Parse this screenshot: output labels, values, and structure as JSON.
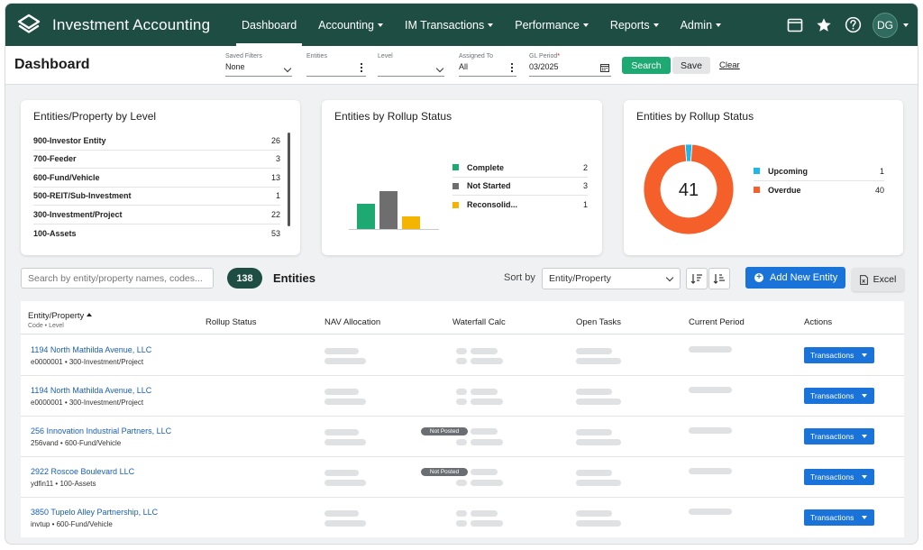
{
  "app": {
    "title": "Investment Accounting",
    "avatar_initials": "DG"
  },
  "nav": [
    {
      "label": "Dashboard",
      "active": true,
      "dropdown": false
    },
    {
      "label": "Accounting",
      "dropdown": true
    },
    {
      "label": "IM Transactions",
      "dropdown": true
    },
    {
      "label": "Performance",
      "dropdown": true
    },
    {
      "label": "Reports",
      "dropdown": true
    },
    {
      "label": "Admin",
      "dropdown": true
    }
  ],
  "header": {
    "title": "Dashboard",
    "filters": {
      "saved_filters": {
        "label": "Saved Filters",
        "value": "None"
      },
      "entities": {
        "label": "Entities",
        "value": ""
      },
      "level": {
        "label": "Level",
        "value": ""
      },
      "assigned_to": {
        "label": "Assigned To",
        "value": "All"
      },
      "gl_period": {
        "label": "GL Period",
        "required_mark": "*",
        "value": "03/2025"
      }
    },
    "search_label": "Search",
    "save_label": "Save",
    "clear_label": "Clear"
  },
  "cards": {
    "levels": {
      "title": "Entities/Property by Level",
      "rows": [
        {
          "label": "900-Investor Entity",
          "count": "26"
        },
        {
          "label": "700-Feeder",
          "count": "3"
        },
        {
          "label": "600-Fund/Vehicle",
          "count": "13"
        },
        {
          "label": "500-REIT/Sub-Investment",
          "count": "1"
        },
        {
          "label": "300-Investment/Project",
          "count": "22"
        },
        {
          "label": "100-Assets",
          "count": "53"
        }
      ]
    },
    "rollup_bar": {
      "title": "Entities by Rollup Status",
      "legend": [
        {
          "label": "Complete",
          "count": "2",
          "color": "#1fa972"
        },
        {
          "label": "Not Started",
          "count": "3",
          "color": "#6e6e6e"
        },
        {
          "label": "Reconsolid...",
          "count": "1",
          "color": "#f5b400"
        }
      ]
    },
    "rollup_donut": {
      "title": "Entities by Rollup Status",
      "total": "41",
      "legend": [
        {
          "label": "Upcoming",
          "count": "1",
          "color": "#1fb6e8"
        },
        {
          "label": "Overdue",
          "count": "40",
          "color": "#f5602a"
        }
      ]
    }
  },
  "chart_data": [
    {
      "type": "bar",
      "categories": [
        "Complete",
        "Not Started",
        "Reconsolid..."
      ],
      "values": [
        2,
        3,
        1
      ],
      "colors": [
        "#1fa972",
        "#6e6e6e",
        "#f5b400"
      ],
      "ylim": [
        0,
        3
      ]
    },
    {
      "type": "pie",
      "categories": [
        "Upcoming",
        "Overdue"
      ],
      "values": [
        1,
        40
      ],
      "colors": [
        "#1fb6e8",
        "#f5602a"
      ],
      "center_label": "41"
    }
  ],
  "toolbar": {
    "search_placeholder": "Search by entity/property names, codes...",
    "count": "138",
    "entities_label": "Entities",
    "sort_by_label": "Sort by",
    "sort_value": "Entity/Property",
    "add_label": "Add New Entity",
    "excel_label": "Excel"
  },
  "table": {
    "columns": {
      "entity": "Entity/Property",
      "entity_sub": "Code • Level",
      "rollup": "Rollup Status",
      "nav": "NAV Allocation",
      "waterfall": "Waterfall Calc",
      "tasks": "Open Tasks",
      "period": "Current Period",
      "actions": "Actions"
    },
    "action_label": "Transactions",
    "rows": [
      {
        "name": "1194 North Mathilda Avenue, LLC",
        "sub": "e0000001 • 300-Investment/Project",
        "badge": ""
      },
      {
        "name": "1194 North Mathilda Avenue, LLC",
        "sub": "e0000001 • 300-Investment/Project",
        "badge": ""
      },
      {
        "name": "256 Innovation Industrial Partners, LLC",
        "sub": "256vand • 600-Fund/Vehicle",
        "badge": "Not Posted"
      },
      {
        "name": "2922 Roscoe Boulevard LLC",
        "sub": "ydfin11 • 100-Assets",
        "badge": "Not Posted"
      },
      {
        "name": "3850 Tupelo Alley Partnership, LLC",
        "sub": "invtup • 600-Fund/Vehicle",
        "badge": ""
      }
    ]
  }
}
